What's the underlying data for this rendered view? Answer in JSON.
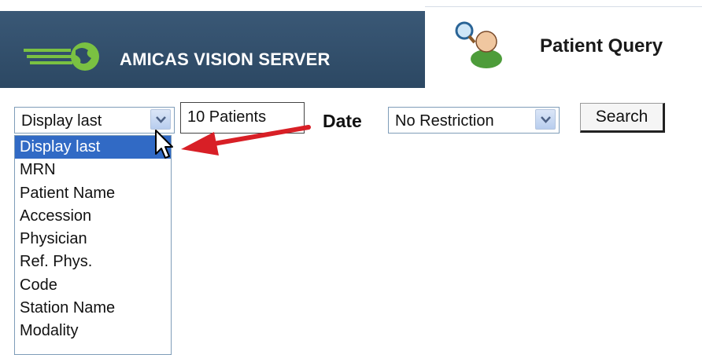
{
  "header": {
    "brand_name": "AMICAS VISION SERVER",
    "tab_title": "Patient Query",
    "colors": {
      "band": "#2e4c68",
      "logo_green": "#7ac142"
    }
  },
  "controls": {
    "display_select_value": "Display last",
    "patients_value": "10 Patients",
    "date_label": "Date",
    "date_select_value": "No Restriction",
    "search_label": "Search"
  },
  "dropdown": {
    "items": [
      "Display last",
      "MRN",
      "Patient Name",
      "Accession",
      "Physician",
      "Ref. Phys.",
      "Code",
      "Station Name",
      "Modality"
    ],
    "selected_index": 0,
    "selected_color": "#316ac5"
  },
  "icons": {
    "logo": "amicas-logo-icon",
    "query": "patient-search-icon",
    "dropdown": "chevron-down-icon",
    "cursor": "mouse-pointer-icon",
    "annotation": "red-arrow-icon"
  }
}
